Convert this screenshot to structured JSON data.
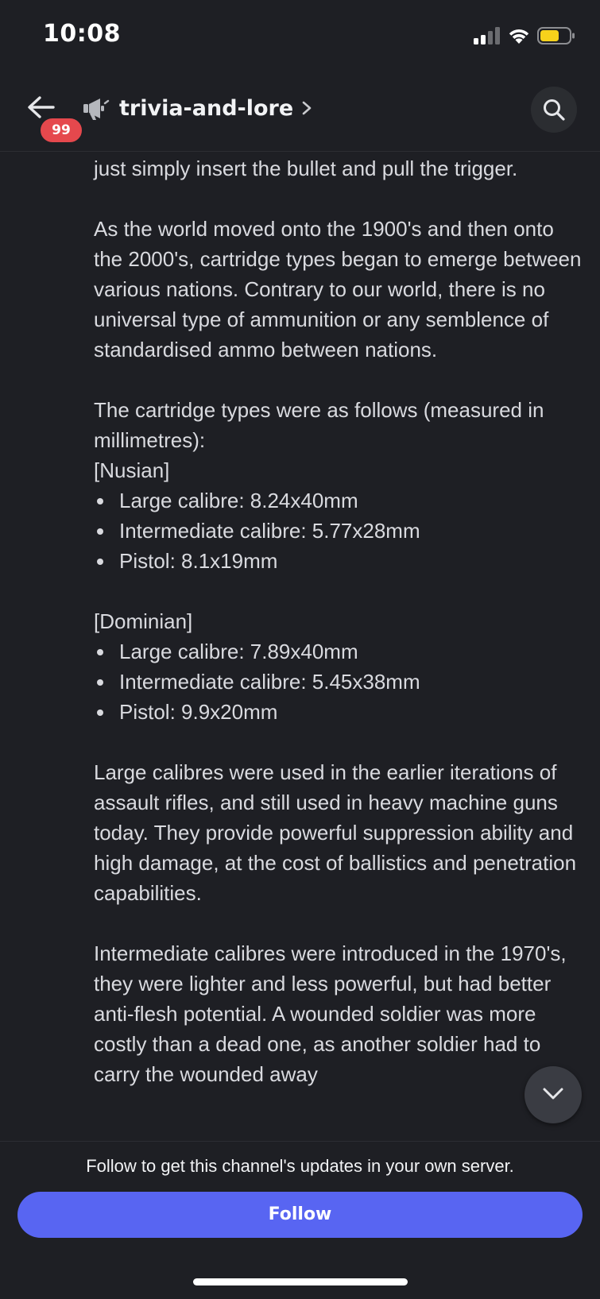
{
  "status_bar": {
    "time": "10:08",
    "signal_icon": "cellular-signal-icon",
    "wifi_icon": "wifi-icon",
    "battery_icon": "battery-icon",
    "battery_color": "#f7d21b"
  },
  "header": {
    "back_icon": "arrow-left-icon",
    "unread_count": "99",
    "channel_icon": "announcement-megaphone-icon",
    "channel_name": "trivia-and-lore",
    "chevron_icon": "chevron-right-icon",
    "search_icon": "search-icon"
  },
  "message": {
    "line_top": "just simply insert the bullet and pull the trigger.",
    "para_1": "As the world moved onto the 1900's and then onto the 2000's, cartridge types began to emerge between various nations. Contrary to our world, there is no universal type of ammunition or any semblence of standardised ammo between nations.",
    "para_2": "The cartridge types were as follows (measured in millimetres):",
    "nusian": {
      "heading": "[Nusian]",
      "items": [
        "Large calibre: 8.24x40mm",
        "Intermediate calibre: 5.77x28mm",
        "Pistol: 8.1x19mm"
      ]
    },
    "dominian": {
      "heading": "[Dominian]",
      "items": [
        "Large calibre: 7.89x40mm",
        "Intermediate calibre: 5.45x38mm",
        "Pistol: 9.9x20mm"
      ]
    },
    "para_3": "Large calibres were used in the earlier iterations of assault rifles, and still used in heavy machine guns today. They provide powerful suppression ability and high damage, at the cost of ballistics and penetration capabilities.",
    "para_4": "Intermediate calibres were introduced in the 1970's, they were lighter and less powerful, but had better anti-flesh potential. A wounded soldier was more costly than a dead one, as another soldier had to carry the wounded away"
  },
  "scroll_down_icon": "chevron-down-icon",
  "footer": {
    "prompt": "Follow to get this channel's updates in your own server.",
    "follow_label": "Follow",
    "accent_color": "#5865f2"
  }
}
